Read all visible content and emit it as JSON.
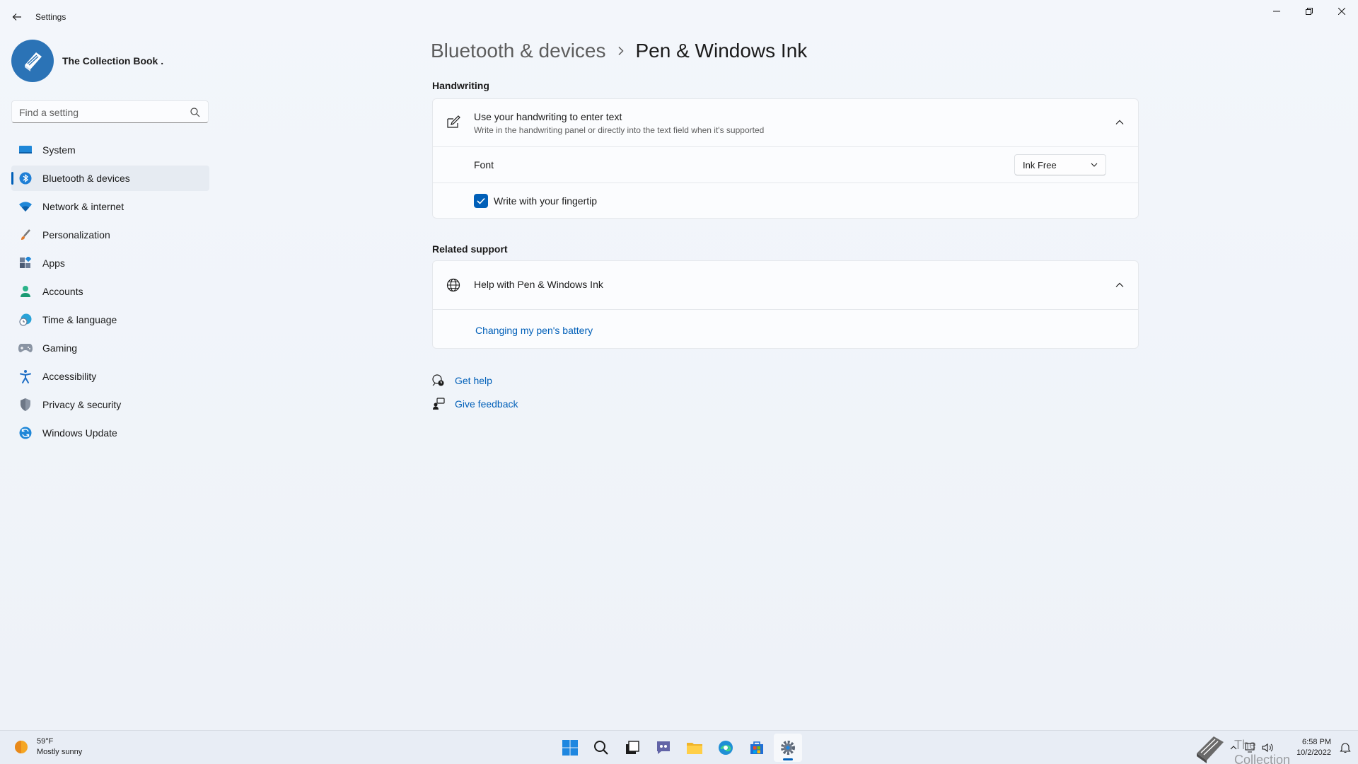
{
  "app": {
    "title": "Settings"
  },
  "profile": {
    "name": "The Collection Book ."
  },
  "search": {
    "placeholder": "Find a setting"
  },
  "sidebar": {
    "items": [
      {
        "label": "System",
        "icon": "monitor-icon"
      },
      {
        "label": "Bluetooth & devices",
        "icon": "bluetooth-icon",
        "active": true
      },
      {
        "label": "Network & internet",
        "icon": "wifi-icon"
      },
      {
        "label": "Personalization",
        "icon": "brush-icon"
      },
      {
        "label": "Apps",
        "icon": "apps-icon"
      },
      {
        "label": "Accounts",
        "icon": "person-icon"
      },
      {
        "label": "Time & language",
        "icon": "globe-clock-icon"
      },
      {
        "label": "Gaming",
        "icon": "gamepad-icon"
      },
      {
        "label": "Accessibility",
        "icon": "accessibility-icon"
      },
      {
        "label": "Privacy & security",
        "icon": "shield-icon"
      },
      {
        "label": "Windows Update",
        "icon": "update-icon"
      }
    ]
  },
  "breadcrumb": {
    "parent": "Bluetooth & devices",
    "current": "Pen & Windows Ink"
  },
  "handwriting": {
    "section_title": "Handwriting",
    "title": "Use your handwriting to enter text",
    "subtitle": "Write in the handwriting panel or directly into the text field when it's supported",
    "font_label": "Font",
    "font_value": "Ink Free",
    "fingertip_label": "Write with your fingertip",
    "fingertip_checked": true
  },
  "related": {
    "section_title": "Related support",
    "help_title": "Help with Pen & Windows Ink",
    "link": "Changing my pen's battery"
  },
  "help": {
    "get_help": "Get help",
    "give_feedback": "Give feedback"
  },
  "taskbar": {
    "weather_temp": "59°F",
    "weather_desc": "Mostly sunny",
    "watermark": "The Collection Book",
    "time": "6:58 PM",
    "date": "10/2/2022"
  },
  "colors": {
    "accent": "#005fb8"
  }
}
